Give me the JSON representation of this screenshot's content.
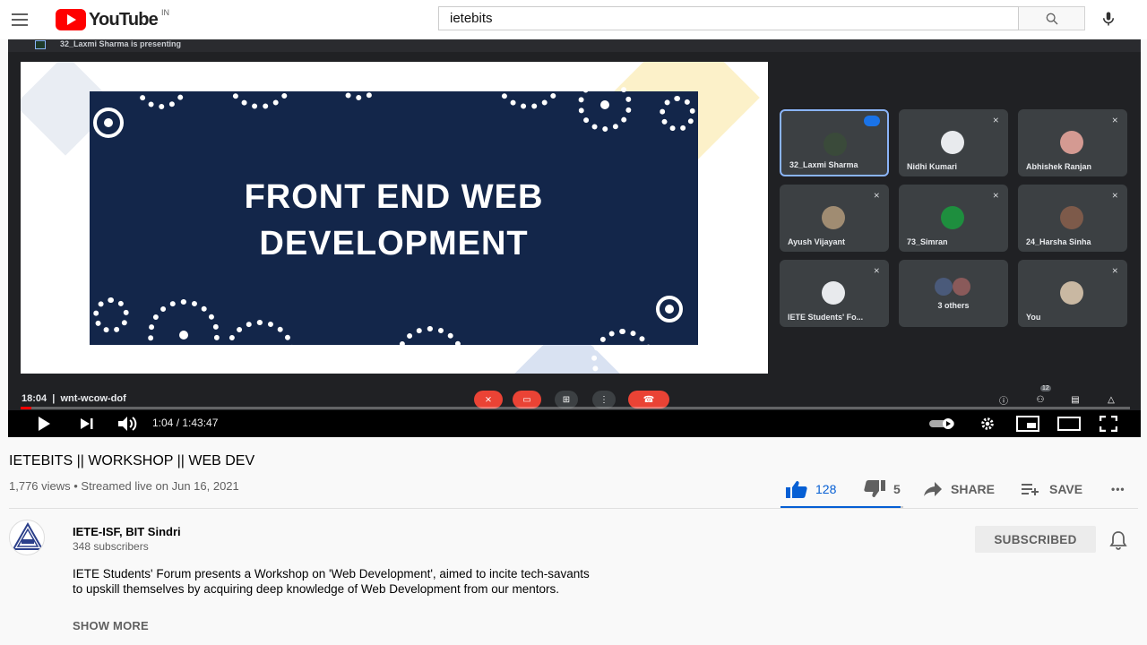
{
  "masthead": {
    "logo_text": "YouTube",
    "region": "IN",
    "search_value": "ietebits"
  },
  "meet": {
    "presenting_text": "32_Laxmi Sharma is presenting",
    "slide_line1": "FRONT END WEB",
    "slide_line2": "DEVELOPMENT",
    "participants": [
      {
        "name": "32_Laxmi Sharma",
        "active": true
      },
      {
        "name": "Nidhi Kumari"
      },
      {
        "name": "Abhishek Ranjan"
      },
      {
        "name": "Ayush Vijayant"
      },
      {
        "name": "73_Simran"
      },
      {
        "name": "24_Harsha Sinha"
      },
      {
        "name": "IETE Students' Fo..."
      },
      {
        "name": "3 others"
      },
      {
        "name": "You"
      }
    ],
    "meeting_time": "18:04",
    "meeting_code": "wnt-wcow-dof",
    "people_count": "12"
  },
  "player": {
    "time_display": "1:04 / 1:43:47",
    "progress_fraction": 0.01
  },
  "video": {
    "title": "IETEBITS || WORKSHOP || WEB DEV",
    "meta": "1,776 views • Streamed live on Jun 16, 2021",
    "likes": "128",
    "dislikes": "5",
    "share_label": "SHARE",
    "save_label": "SAVE",
    "more_label": "•••"
  },
  "channel": {
    "name": "IETE-ISF, BIT Sindri",
    "subscribers": "348 subscribers",
    "subscribe_label": "SUBSCRIBED",
    "description_line1": "IETE Students' Forum presents a Workshop on 'Web Development', aimed to incite tech-savants",
    "description_line2": "to upskill themselves by acquiring deep knowledge of Web Development from our mentors.",
    "show_more": "SHOW MORE"
  },
  "colors": {
    "brand_red": "#ff0000",
    "like_blue": "#065fd4",
    "meet_bg": "#202124",
    "slide_navy": "#13264a",
    "end_call_red": "#ea4335"
  }
}
